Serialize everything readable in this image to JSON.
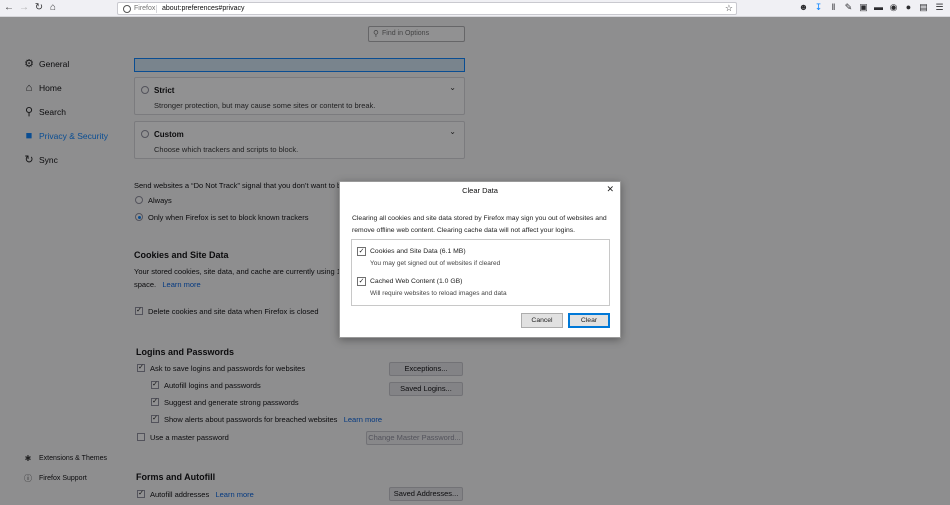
{
  "toolbar": {
    "identity": "Firefox",
    "url": "about:preferences#privacy"
  },
  "find": {
    "placeholder": "Find in Options"
  },
  "sidebar": {
    "items": [
      {
        "label": "General",
        "icon": "gear-icon"
      },
      {
        "label": "Home",
        "icon": "home-icon"
      },
      {
        "label": "Search",
        "icon": "search-icon"
      },
      {
        "label": "Privacy & Security",
        "icon": "lock-icon"
      },
      {
        "label": "Sync",
        "icon": "sync-icon"
      }
    ],
    "footer": [
      {
        "label": "Extensions & Themes",
        "icon": "puzzle-icon"
      },
      {
        "label": "Firefox Support",
        "icon": "help-icon"
      }
    ]
  },
  "tracking": {
    "strict": {
      "title": "Strict",
      "desc": "Stronger protection, but may cause some sites or content to break."
    },
    "custom": {
      "title": "Custom",
      "desc": "Choose which trackers and scripts to block."
    }
  },
  "dnt": {
    "label": "Send websites a “Do Not Track” signal that you don’t want to b",
    "always": "Always",
    "only_when": "Only when Firefox is set to block known trackers"
  },
  "cookies": {
    "heading": "Cookies and Site Data",
    "line1": "Your stored cookies, site data, and cache are currently using 1.",
    "line2": "space.",
    "learn_more": "Learn more",
    "delete_label": "Delete cookies and site data when Firefox is closed"
  },
  "logins": {
    "heading": "Logins and Passwords",
    "ask_save": "Ask to save logins and passwords for websites",
    "autofill": "Autofill logins and passwords",
    "suggest": "Suggest and generate strong passwords",
    "alerts": "Show alerts about passwords for breached websites",
    "learn_more": "Learn more",
    "master": "Use a master password",
    "exceptions_btn": "Exceptions...",
    "saved_logins_btn": "Saved Logins...",
    "change_master_btn": "Change Master Password..."
  },
  "forms": {
    "heading": "Forms and Autofill",
    "autofill_addresses": "Autofill addresses",
    "learn_more": "Learn more",
    "saved_addresses_btn": "Saved Addresses..."
  },
  "dialog": {
    "title": "Clear Data",
    "intro": "Clearing all cookies and site data stored by Firefox may sign you out of websites and remove offline web content. Clearing cache data will not affect your logins.",
    "option1_label": "Cookies and Site Data (6.1 MB)",
    "option1_sub": "You may get signed out of websites if cleared",
    "option2_label": "Cached Web Content (1.0 GB)",
    "option2_sub": "Will require websites to reload images and data",
    "cancel": "Cancel",
    "clear": "Clear"
  }
}
